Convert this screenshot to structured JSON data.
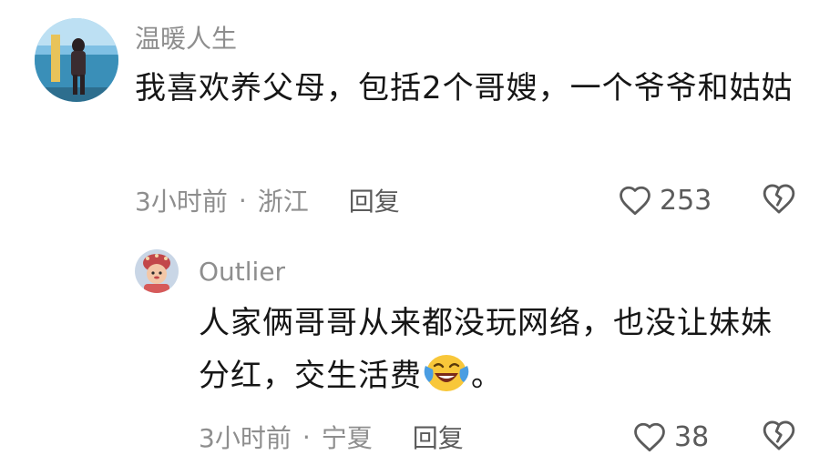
{
  "comments": [
    {
      "username": "温暖人生",
      "content": "我喜欢养父母，包括2个哥嫂，一个爷爷和姑姑",
      "time": "3小时前",
      "dot": "·",
      "location": "浙江",
      "reply_label": "回复",
      "like_count": "253"
    },
    {
      "username": "Outlier",
      "content_before": "人家俩哥哥从来都没玩网络，也没让妹妹分红，交生活费",
      "content_after": "。",
      "emoji": "crying-laughing-emoji",
      "time": "3小时前",
      "dot": "·",
      "location": "宁夏",
      "reply_label": "回复",
      "like_count": "38"
    }
  ],
  "icons": {
    "like": "heart-outline-icon",
    "dislike": "broken-heart-icon"
  },
  "colors": {
    "username": "#8e8e8e",
    "text": "#161616",
    "meta": "#8e8e8e",
    "icon": "#5b5b5b"
  }
}
